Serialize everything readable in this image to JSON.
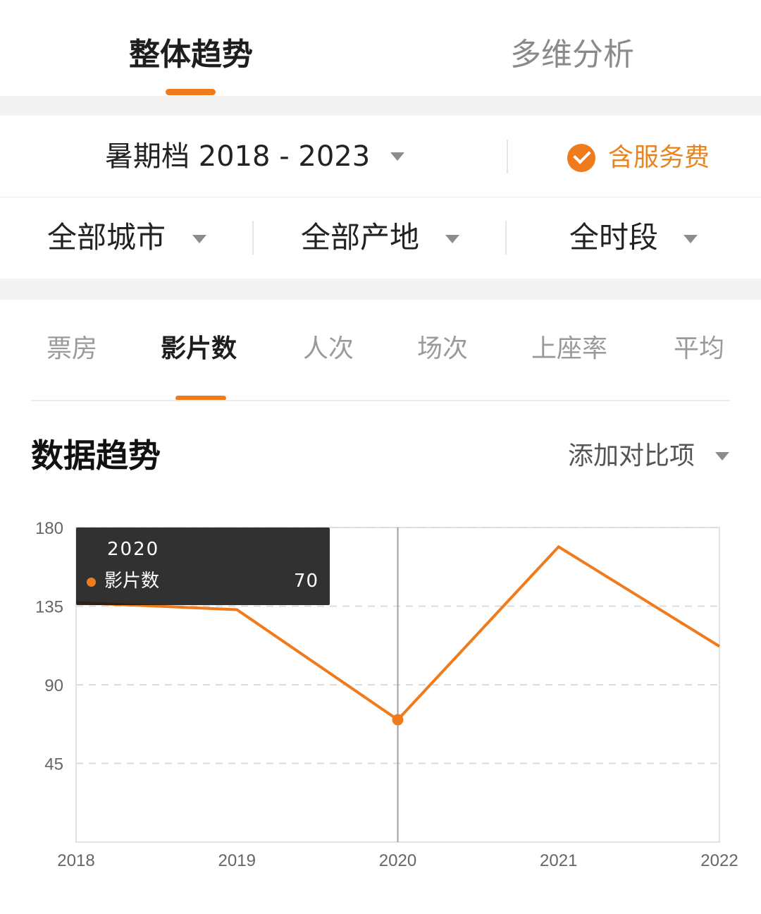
{
  "top_tabs": [
    {
      "label": "整体趋势",
      "active": true
    },
    {
      "label": "多维分析",
      "active": false
    }
  ],
  "filters": {
    "season": "暑期档 2018 - 2023",
    "service_fee_label": "含服务费",
    "service_fee_checked": true,
    "city": "全部城市",
    "origin": "全部产地",
    "time_slot": "全时段"
  },
  "metric_tabs": [
    {
      "label": "票房",
      "active": false
    },
    {
      "label": "影片数",
      "active": true
    },
    {
      "label": "人次",
      "active": false
    },
    {
      "label": "场次",
      "active": false
    },
    {
      "label": "上座率",
      "active": false
    },
    {
      "label": "平均",
      "active": false
    }
  ],
  "section": {
    "title": "数据趋势",
    "compare_label": "添加对比项"
  },
  "tooltip": {
    "title": "2020",
    "series_name": "影片数",
    "value": "70"
  },
  "colors": {
    "accent": "#f07b1d",
    "service_text": "#e8841f"
  },
  "chart_data": {
    "type": "line",
    "x": [
      "2018",
      "2019",
      "2020",
      "2021",
      "2022"
    ],
    "series": [
      {
        "name": "影片数",
        "values": [
          137,
          133,
          70,
          169,
          112
        ]
      }
    ],
    "ylim": [
      0,
      180
    ],
    "yticks": [
      "45",
      "90",
      "135",
      "180"
    ],
    "selected_index": 2,
    "grid": true,
    "title": "",
    "xlabel": "",
    "ylabel": ""
  }
}
